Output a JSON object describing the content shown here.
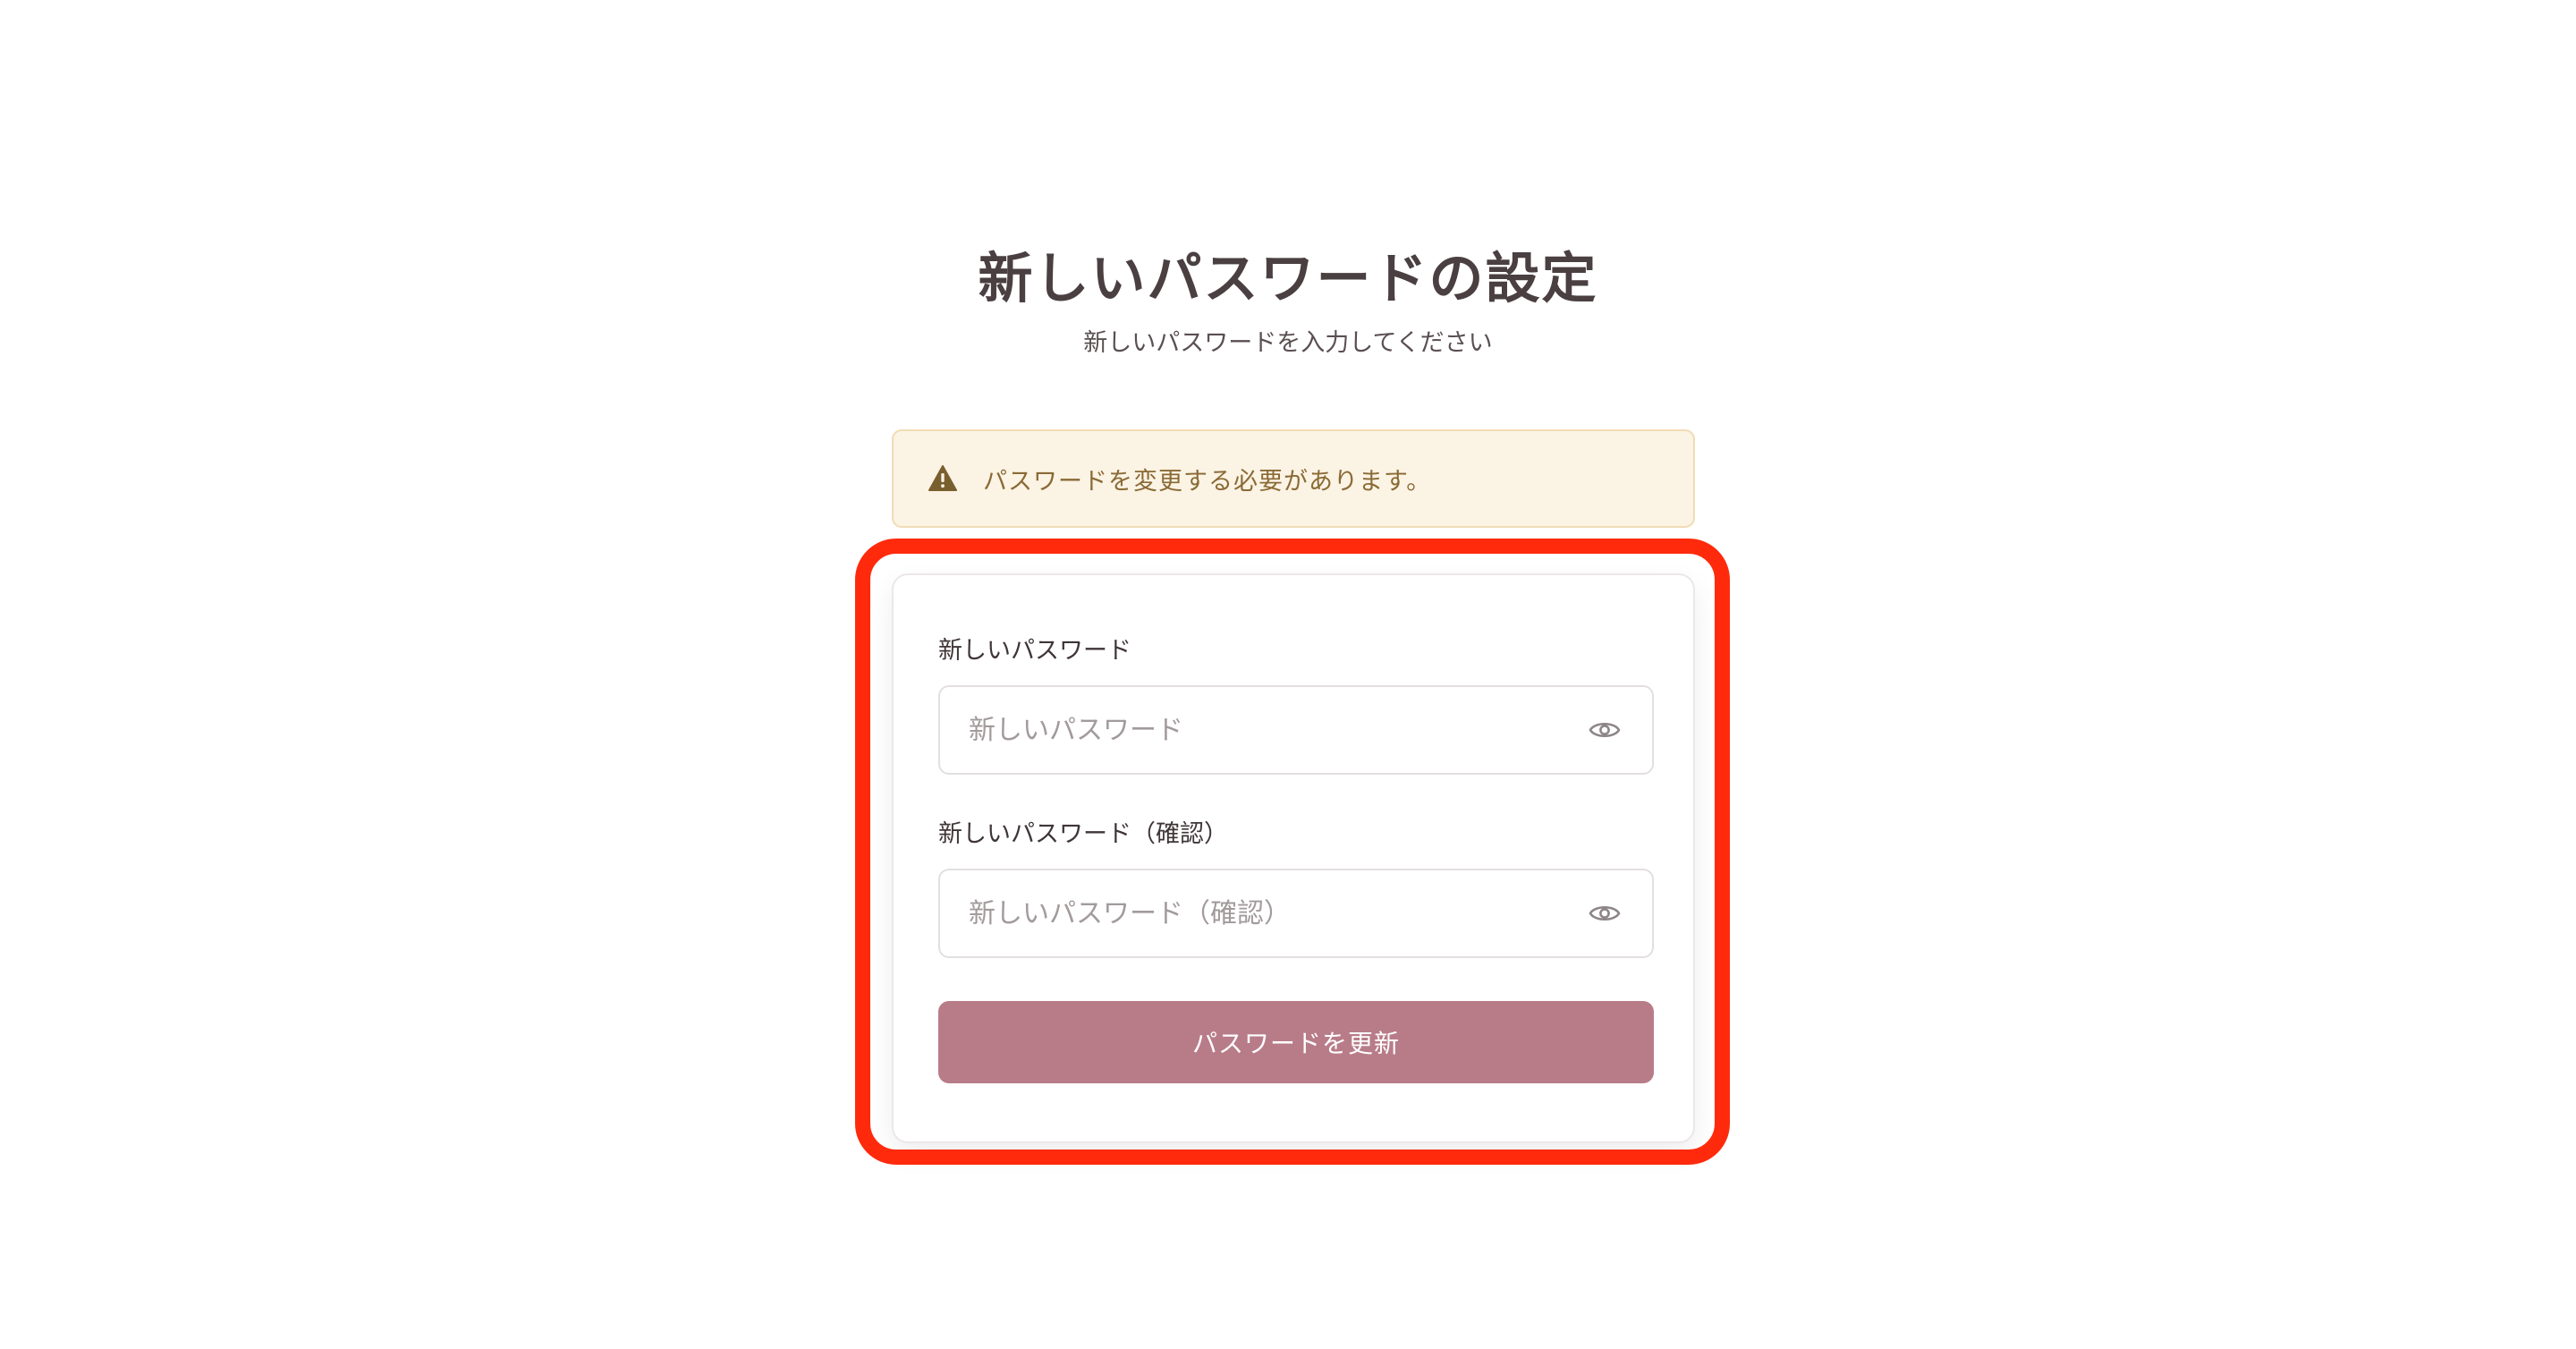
{
  "header": {
    "title": "新しいパスワードの設定",
    "subtitle": "新しいパスワードを入力してください"
  },
  "alert": {
    "icon": "warning-icon",
    "text": "パスワードを変更する必要があります。",
    "background_color": "#fbf3e4",
    "text_color": "#8a6a35"
  },
  "form": {
    "new_password": {
      "label": "新しいパスワード",
      "placeholder": "新しいパスワード",
      "value": "",
      "toggle_icon": "eye-icon"
    },
    "confirm_password": {
      "label": "新しいパスワード（確認）",
      "placeholder": "新しいパスワード（確認）",
      "value": "",
      "toggle_icon": "eye-icon"
    },
    "submit_label": "パスワードを更新",
    "submit_color": "#b87c89"
  },
  "highlight_color": "#ff2a0c"
}
